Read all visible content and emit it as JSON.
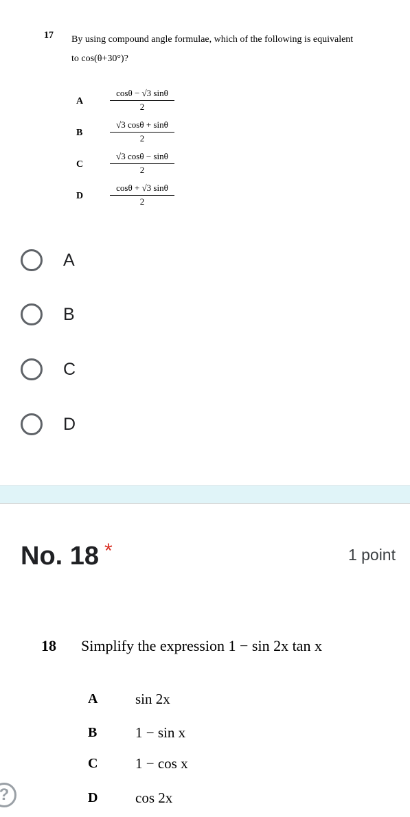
{
  "q17": {
    "number": "17",
    "question_prefix": "By using compound angle formulae, which of the following is equivalent",
    "question_line2_to": "to",
    "question_expr": "cos(θ+30°)?",
    "options": [
      {
        "letter": "A",
        "numerator": "cosθ − √3 sinθ",
        "denominator": "2"
      },
      {
        "letter": "B",
        "numerator": "√3 cosθ + sinθ",
        "denominator": "2"
      },
      {
        "letter": "C",
        "numerator": "√3 cosθ − sinθ",
        "denominator": "2"
      },
      {
        "letter": "D",
        "numerator": "cosθ + √3 sinθ",
        "denominator": "2"
      }
    ]
  },
  "q17_choices": [
    "A",
    "B",
    "C",
    "D"
  ],
  "q18": {
    "title": "No. 18",
    "required_mark": "*",
    "points": "1 point",
    "number": "18",
    "question": "Simplify the expression",
    "question_expr": "1 − sin 2x tan x",
    "options": [
      {
        "letter": "A",
        "expr": "sin 2x"
      },
      {
        "letter": "B",
        "expr": "1 − sin x"
      },
      {
        "letter": "C",
        "expr": "1 − cos x"
      },
      {
        "letter": "D",
        "expr": "cos 2x"
      }
    ]
  },
  "icons": {
    "help": "help-icon"
  }
}
